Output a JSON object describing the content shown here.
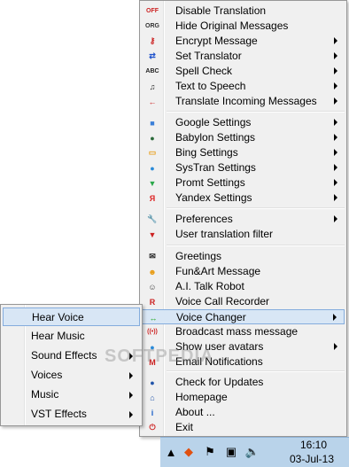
{
  "main_menu": {
    "group1": [
      {
        "icon": "off-icon",
        "glyph": "OFF",
        "color": "#cc2222",
        "label": "Disable Translation",
        "arrow": false
      },
      {
        "icon": "org-icon",
        "glyph": "ORG",
        "color": "#333333",
        "label": "Hide Original Messages",
        "arrow": false
      },
      {
        "icon": "key-icon",
        "glyph": "⚷",
        "color": "#cc2222",
        "label": "Encrypt Message",
        "arrow": true
      },
      {
        "icon": "swap-arrows-icon",
        "glyph": "⇄",
        "color": "#2255cc",
        "label": "Set Translator",
        "arrow": true
      },
      {
        "icon": "abc-check-icon",
        "glyph": "ABC",
        "color": "#222222",
        "label": "Spell Check",
        "arrow": true
      },
      {
        "icon": "music-note-icon",
        "glyph": "♫",
        "color": "#222222",
        "label": "Text to Speech",
        "arrow": true
      },
      {
        "icon": "left-arrow-icon",
        "glyph": "←",
        "color": "#cc2222",
        "label": "Translate Incoming Messages",
        "arrow": true
      }
    ],
    "group2": [
      {
        "icon": "google-icon",
        "glyph": "■",
        "color": "#3a7fd8",
        "label": "Google Settings",
        "arrow": true
      },
      {
        "icon": "babylon-icon",
        "glyph": "●",
        "color": "#2a6a3a",
        "label": "Babylon Settings",
        "arrow": true
      },
      {
        "icon": "bing-icon",
        "glyph": "▭",
        "color": "#e8a020",
        "label": "Bing Settings",
        "arrow": true
      },
      {
        "icon": "systran-globe-icon",
        "glyph": "●",
        "color": "#2a8ad8",
        "label": "SysTran Settings",
        "arrow": true
      },
      {
        "icon": "promt-icon",
        "glyph": "▼",
        "color": "#2aa84a",
        "label": "Promt Settings",
        "arrow": true
      },
      {
        "icon": "yandex-icon",
        "glyph": "Я",
        "color": "#dd2222",
        "label": "Yandex Settings",
        "arrow": true
      }
    ],
    "group3": [
      {
        "icon": "wrench-icon",
        "glyph": "🔧",
        "color": "#555555",
        "label": "Preferences",
        "arrow": true
      },
      {
        "icon": "filter-icon",
        "glyph": "▼",
        "color": "#cc2222",
        "label": "User translation filter",
        "arrow": false
      }
    ],
    "group4": [
      {
        "icon": "envelope-icon",
        "glyph": "✉",
        "color": "#222222",
        "label": "Greetings",
        "arrow": false
      },
      {
        "icon": "smiley-icon",
        "glyph": "☻",
        "color": "#e89a10",
        "label": "Fun&Art Message",
        "arrow": false
      },
      {
        "icon": "robot-icon",
        "glyph": "☺",
        "color": "#444444",
        "label": "A.I. Talk Robot",
        "arrow": false
      },
      {
        "icon": "recorder-icon",
        "glyph": "R",
        "color": "#cc2222",
        "label": "Voice Call Recorder",
        "arrow": false
      },
      {
        "icon": "voice-changer-icon",
        "glyph": "↔",
        "color": "#22aa22",
        "label": "Voice Changer",
        "arrow": true,
        "highlighted": true
      },
      {
        "icon": "broadcast-icon",
        "glyph": "((•))",
        "color": "#cc2222",
        "label": "Broadcast mass message",
        "arrow": false
      },
      {
        "icon": "avatar-icon",
        "glyph": "●",
        "color": "#2a8ad8",
        "label": "Show user avatars",
        "arrow": true
      },
      {
        "icon": "gmail-icon",
        "glyph": "M",
        "color": "#cc2222",
        "label": "Email Notifications",
        "arrow": false
      }
    ],
    "group5": [
      {
        "icon": "update-icon",
        "glyph": "●",
        "color": "#2255aa",
        "label": "Check for Updates",
        "arrow": false
      },
      {
        "icon": "home-icon",
        "glyph": "⌂",
        "color": "#2255aa",
        "label": "Homepage",
        "arrow": false
      },
      {
        "icon": "info-icon",
        "glyph": "i",
        "color": "#1a5fc8",
        "label": "About ...",
        "arrow": false
      },
      {
        "icon": "power-icon",
        "glyph": "⏻",
        "color": "#cc2222",
        "label": "Exit",
        "arrow": false
      }
    ]
  },
  "sub_menu": [
    {
      "label": "Hear Voice",
      "arrow": false,
      "highlighted": true
    },
    {
      "label": "Hear Music",
      "arrow": false
    },
    {
      "label": "Sound Effects",
      "arrow": true
    },
    {
      "label": "Voices",
      "arrow": true
    },
    {
      "label": "Music",
      "arrow": true
    },
    {
      "label": "VST Effects",
      "arrow": true
    }
  ],
  "taskbar": {
    "time": "16:10",
    "date": "03-Jul-13",
    "tray_icons": [
      "chevron-up-icon",
      "fish-app-icon",
      "flag-icon",
      "network-icon",
      "speaker-icon"
    ]
  },
  "watermark": "SOFTPEDIA"
}
